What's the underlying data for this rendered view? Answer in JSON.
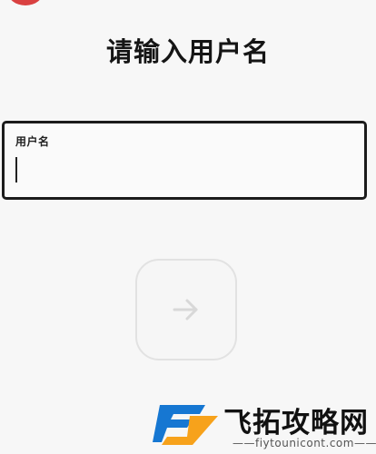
{
  "page": {
    "title": "请输入用户名"
  },
  "form": {
    "username_label": "用户名",
    "username_value": ""
  },
  "actions": {
    "next_icon": "arrow-right-icon"
  },
  "watermark": {
    "site_name": "飞拓攻略网",
    "url": "——fiytounicont.com——"
  },
  "colors": {
    "accent_red": "#d94141",
    "logo_orange": "#f7a21b",
    "logo_blue": "#1677d2",
    "text_dark": "#151515",
    "field_border": "#1b1b1b"
  }
}
